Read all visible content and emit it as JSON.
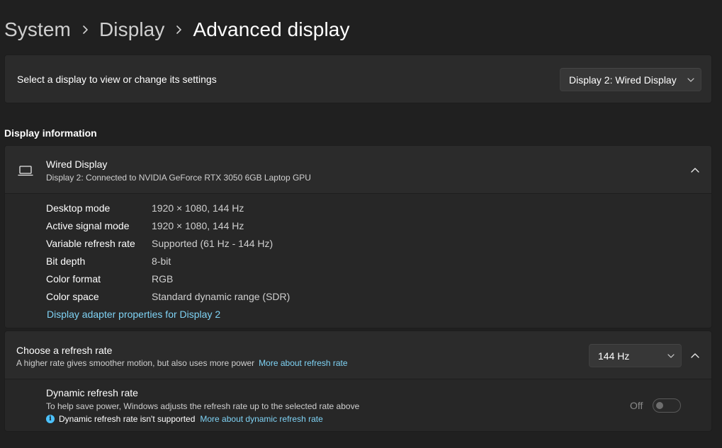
{
  "breadcrumb": {
    "items": [
      "System",
      "Display",
      "Advanced display"
    ]
  },
  "display_select": {
    "label": "Select a display to view or change its settings",
    "selected": "Display 2: Wired Display"
  },
  "display_information": {
    "section_title": "Display information",
    "title": "Wired Display",
    "subtitle": "Display 2: Connected to NVIDIA GeForce RTX 3050 6GB Laptop GPU",
    "rows": [
      {
        "key": "Desktop mode",
        "value": "1920 × 1080, 144 Hz"
      },
      {
        "key": "Active signal mode",
        "value": "1920 × 1080, 144 Hz"
      },
      {
        "key": "Variable refresh rate",
        "value": "Supported (61 Hz - 144 Hz)"
      },
      {
        "key": "Bit depth",
        "value": "8-bit"
      },
      {
        "key": "Color format",
        "value": "RGB"
      },
      {
        "key": "Color space",
        "value": "Standard dynamic range (SDR)"
      }
    ],
    "adapter_link": "Display adapter properties for Display 2"
  },
  "refresh_rate": {
    "title": "Choose a refresh rate",
    "subtitle": "A higher rate gives smoother motion, but also uses more power",
    "more_link": "More about refresh rate",
    "selected": "144 Hz"
  },
  "dynamic_refresh": {
    "title": "Dynamic refresh rate",
    "subtitle": "To help save power, Windows adjusts the refresh rate up to the selected rate above",
    "note": "Dynamic refresh rate isn't supported",
    "more_link": "More about dynamic refresh rate",
    "toggle_label": "Off",
    "toggle_on": false
  },
  "colors": {
    "background": "#202020",
    "card": "#2b2b2b",
    "link": "#7fd3f5",
    "accent": "#4cc2ff"
  }
}
